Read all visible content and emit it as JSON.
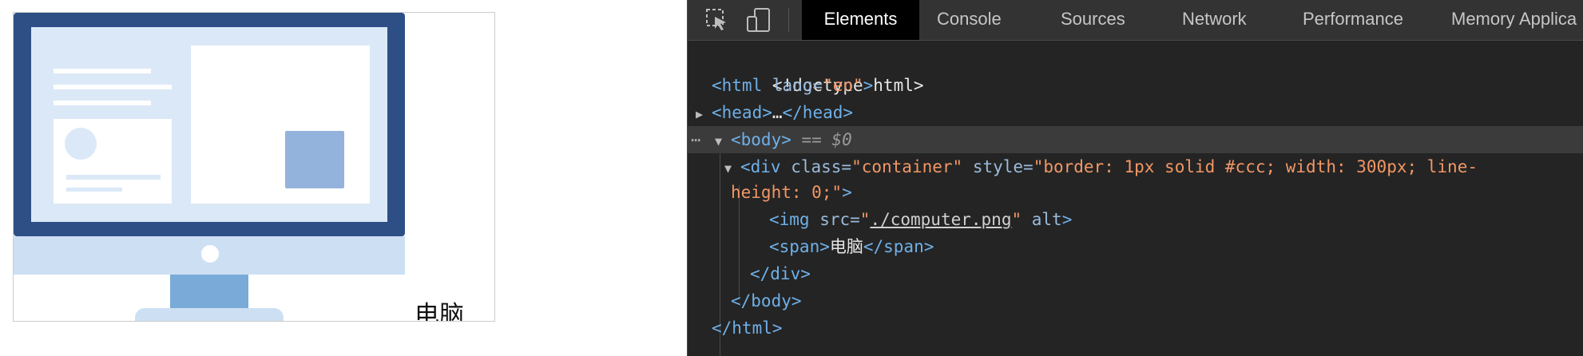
{
  "preview": {
    "caption": "电脑",
    "image_alt": "computer illustration"
  },
  "devtools": {
    "tabs": [
      "Elements",
      "Console",
      "Sources",
      "Network",
      "Performance",
      "Memory",
      "Applica"
    ],
    "active_tab": "Elements",
    "toolbar_icons": [
      "inspect-element-icon",
      "device-toolbar-icon"
    ],
    "dom": {
      "doctype": "<!doctype html>",
      "html_open": "<html",
      "html_lang_attr": " lang=",
      "html_lang_val": "\"en\"",
      "html_close_bracket": ">",
      "head": "<head>",
      "head_ellipsis": "…",
      "head_close": "</head>",
      "body_open": "<body>",
      "body_selected_marker": " == $0",
      "div_open": "<div",
      "div_class_attr": " class=",
      "div_class_val": "\"container\"",
      "div_style_attr": " style=",
      "div_style_val_1": "\"border: 1px solid #ccc; width: 300px; line-",
      "div_style_val_2": "height: 0;\"",
      "div_open_end": ">",
      "img_open": "<img",
      "img_src_attr": " src=",
      "img_src_q1": "\"",
      "img_src_val": "./computer.png",
      "img_src_q2": "\"",
      "img_alt_attr": " alt",
      "img_end": ">",
      "span_open": "<span>",
      "span_text": "电脑",
      "span_close": "</span>",
      "div_close": "</div>",
      "body_close": "</body>",
      "html_close": "</html>"
    }
  },
  "colors": {
    "monitor_frame": "#2e4f86",
    "screen_bg": "#dbe8f7",
    "monitor_base": "#cde0f3",
    "stand": "#7aaad8",
    "square": "#93b3dc",
    "devtools_bg": "#242424",
    "tag": "#6fb0e8",
    "attr_value": "#f29766"
  }
}
